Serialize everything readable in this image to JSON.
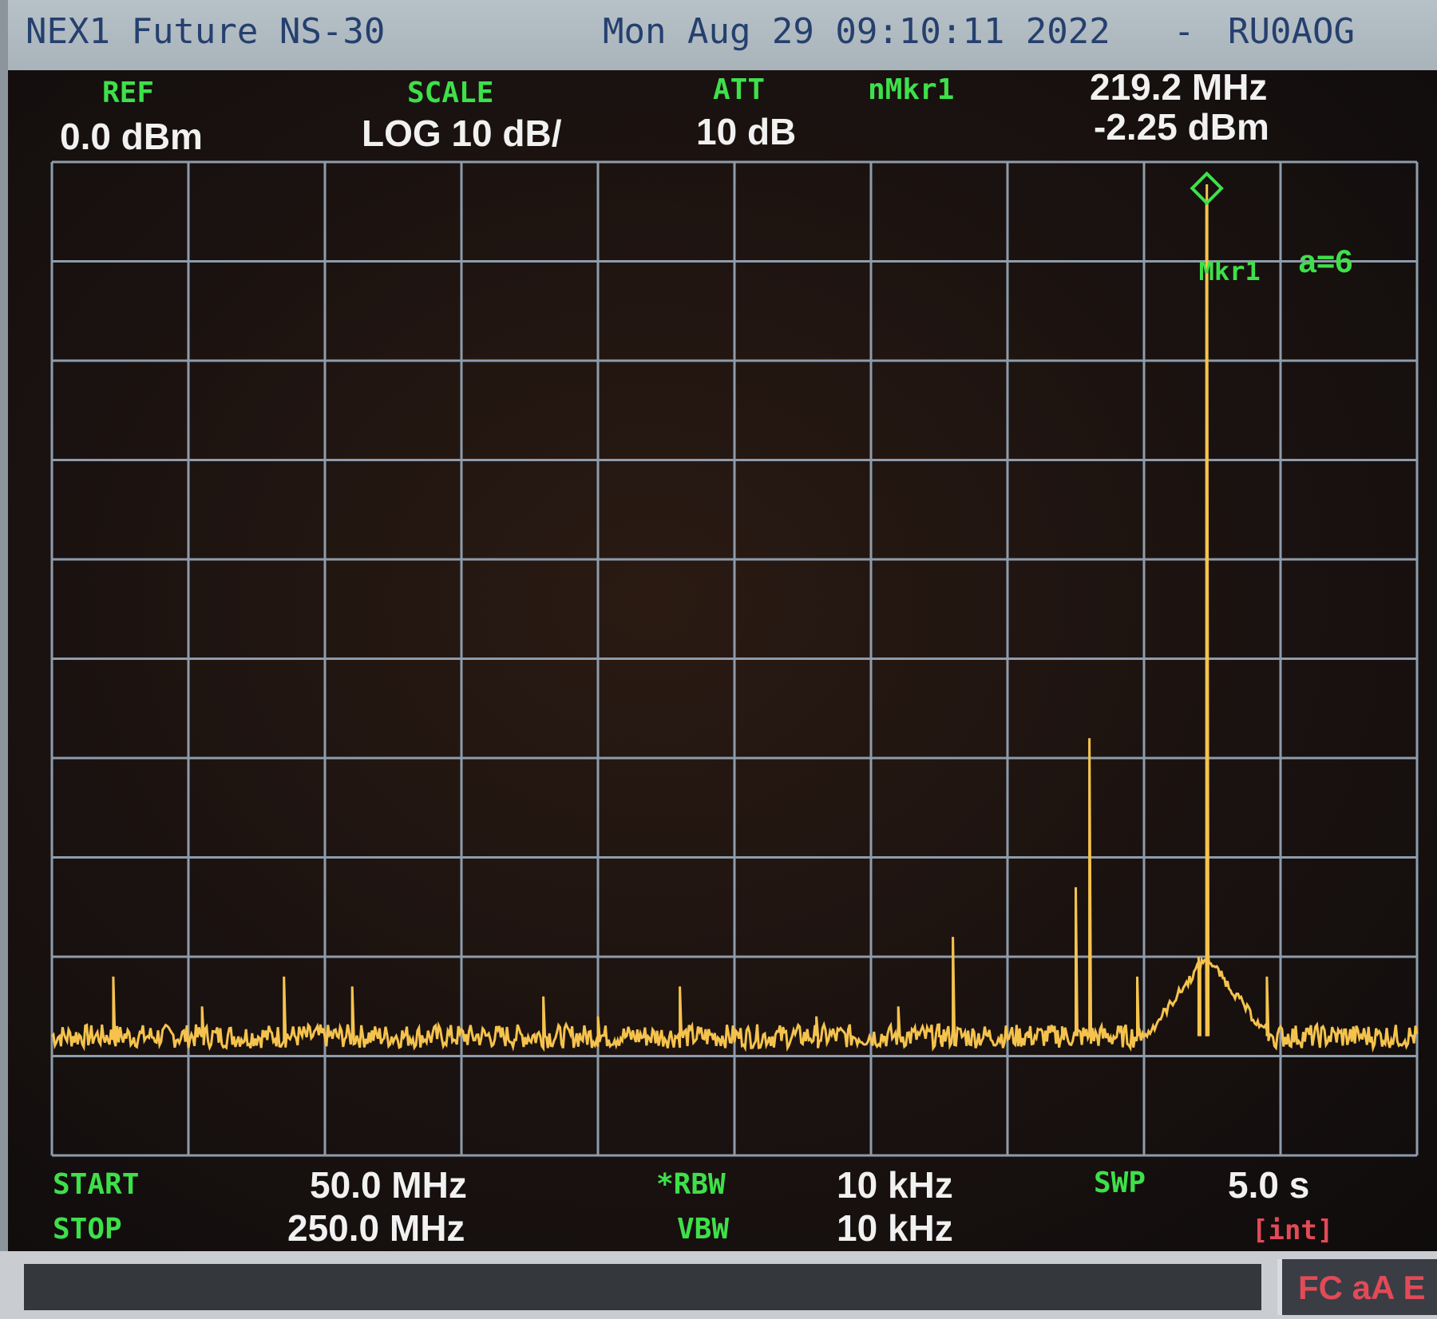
{
  "titlebar": {
    "model": "NEX1 Future NS-30",
    "datetime": "Mon Aug 29 09:10:11 2022",
    "separator": "-",
    "callsign": "RU0AOG"
  },
  "header": {
    "ref_label": "REF",
    "ref_value": "0.0 dBm",
    "scale_label": "SCALE",
    "scale_value": "LOG 10 dB/",
    "att_label": "ATT",
    "att_value": "10 dB",
    "marker_label": "nMkr1",
    "marker_freq": "219.2 MHz",
    "marker_level": "-2.25 dBm"
  },
  "plot": {
    "marker_tag": "Mkr1",
    "avg_tag": "a=6",
    "colors": {
      "trace": "#f5c34d",
      "grid": "#8e9cab",
      "marker": "#3ee04a"
    }
  },
  "footer": {
    "start_label": "START",
    "start_value": "50.0 MHz",
    "stop_label": "STOP",
    "stop_value": "250.0 MHz",
    "rbw_label": "*RBW",
    "rbw_value": "10 kHz",
    "vbw_label": "VBW",
    "vbw_value": "10 kHz",
    "swp_label": "SWP",
    "swp_value": "5.0 s",
    "trigger": "[int]"
  },
  "statusbar": {
    "flags": "FC aA E"
  },
  "chart_data": {
    "type": "line",
    "x_unit": "MHz",
    "y_unit": "dBm",
    "xlim": [
      50,
      250
    ],
    "ylim": [
      -100,
      0
    ],
    "grid": true,
    "noise_floor_dbm": -88,
    "peak_marker": {
      "x": 219.2,
      "y": -2.25
    },
    "spurs": {
      "x": [
        59,
        72,
        84,
        94,
        122,
        130,
        142,
        162,
        174,
        180,
        182,
        198,
        200,
        202,
        209,
        218,
        219.2,
        228
      ],
      "y": [
        -82,
        -85,
        -82,
        -83,
        -84,
        -86,
        -83,
        -86,
        -85,
        -88,
        -78,
        -87,
        -73,
        -58,
        -82,
        -80,
        -2.25,
        -82
      ]
    }
  }
}
